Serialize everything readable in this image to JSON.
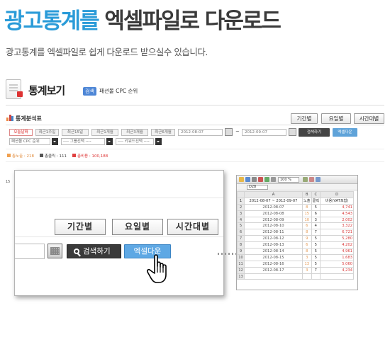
{
  "hero": {
    "title_highlight": "광고통계를",
    "title_rest": "엑셀파일로 다운로드",
    "subtitle": "광고통계를 엑셀파일로 쉽게 다운로드 받으실수 있습니다."
  },
  "page": {
    "heading": "통계보기",
    "ad_badge": "검색",
    "ad_name": "패션몰 CPC 순위",
    "table_title": "통계분석표",
    "view_buttons": [
      "기간별",
      "요일별",
      "시간대별"
    ],
    "period_tabs": [
      "오늘날짜",
      "최근1주일",
      "최근15일",
      "최근1개월",
      "최근3개월",
      "최근6개월"
    ],
    "date_from": "2012-08-07",
    "date_to": "2012-09-07",
    "range_separator": "~",
    "search_label": "검색하기",
    "excel_label": "엑셀다운",
    "filters": [
      "패션몰 CPC 순위",
      "---- 그룹선택 ----",
      "---- 키워드선택 ----"
    ],
    "legend": [
      {
        "label": "총노출 : 218",
        "color": "#f0a050"
      },
      {
        "label": "총클릭 : 111",
        "color": "#555555"
      },
      {
        "label": "총비용 : 100,188",
        "color": "#e04040"
      }
    ],
    "chart_y_label": "15"
  },
  "zoom": {
    "view_buttons": [
      "기간별",
      "요일별",
      "시간대별"
    ],
    "search_label": "검색하기",
    "excel_label": "엑셀다운"
  },
  "excel": {
    "zoom_level": "100 %",
    "cell_ref": "D28",
    "columns": [
      "A",
      "B",
      "C",
      "D"
    ],
    "header": {
      "range": "2012-08-07 ~ 2012-09-07",
      "impressions": "노출",
      "clicks": "클릭",
      "cost": "비용(VAT포함)"
    },
    "rows": [
      {
        "n": "1",
        "date": "",
        "imp": "",
        "clk": "",
        "cost": ""
      },
      {
        "n": "2",
        "date": "2012-08-07",
        "imp": "8",
        "clk": "5",
        "cost": "4,741"
      },
      {
        "n": "3",
        "date": "2012-08-08",
        "imp": "15",
        "clk": "6",
        "cost": "4,543"
      },
      {
        "n": "4",
        "date": "2012-08-09",
        "imp": "10",
        "clk": "3",
        "cost": "2,002"
      },
      {
        "n": "5",
        "date": "2012-08-10",
        "imp": "6",
        "clk": "4",
        "cost": "3,322"
      },
      {
        "n": "6",
        "date": "2012-08-11",
        "imp": "8",
        "clk": "7",
        "cost": "6,721"
      },
      {
        "n": "7",
        "date": "2012-08-12",
        "imp": "9",
        "clk": "5",
        "cost": "5,280"
      },
      {
        "n": "8",
        "date": "2012-08-13",
        "imp": "6",
        "clk": "5",
        "cost": "4,202"
      },
      {
        "n": "9",
        "date": "2012-08-14",
        "imp": "8",
        "clk": "5",
        "cost": "4,961"
      },
      {
        "n": "10",
        "date": "2012-08-15",
        "imp": "3",
        "clk": "5",
        "cost": "1,683"
      },
      {
        "n": "11",
        "date": "2012-08-16",
        "imp": "13",
        "clk": "5",
        "cost": "5,060"
      },
      {
        "n": "12",
        "date": "2012-08-17",
        "imp": "3",
        "clk": "7",
        "cost": "4,234"
      },
      {
        "n": "13",
        "date": "",
        "imp": "",
        "clk": "",
        "cost": ""
      }
    ]
  }
}
